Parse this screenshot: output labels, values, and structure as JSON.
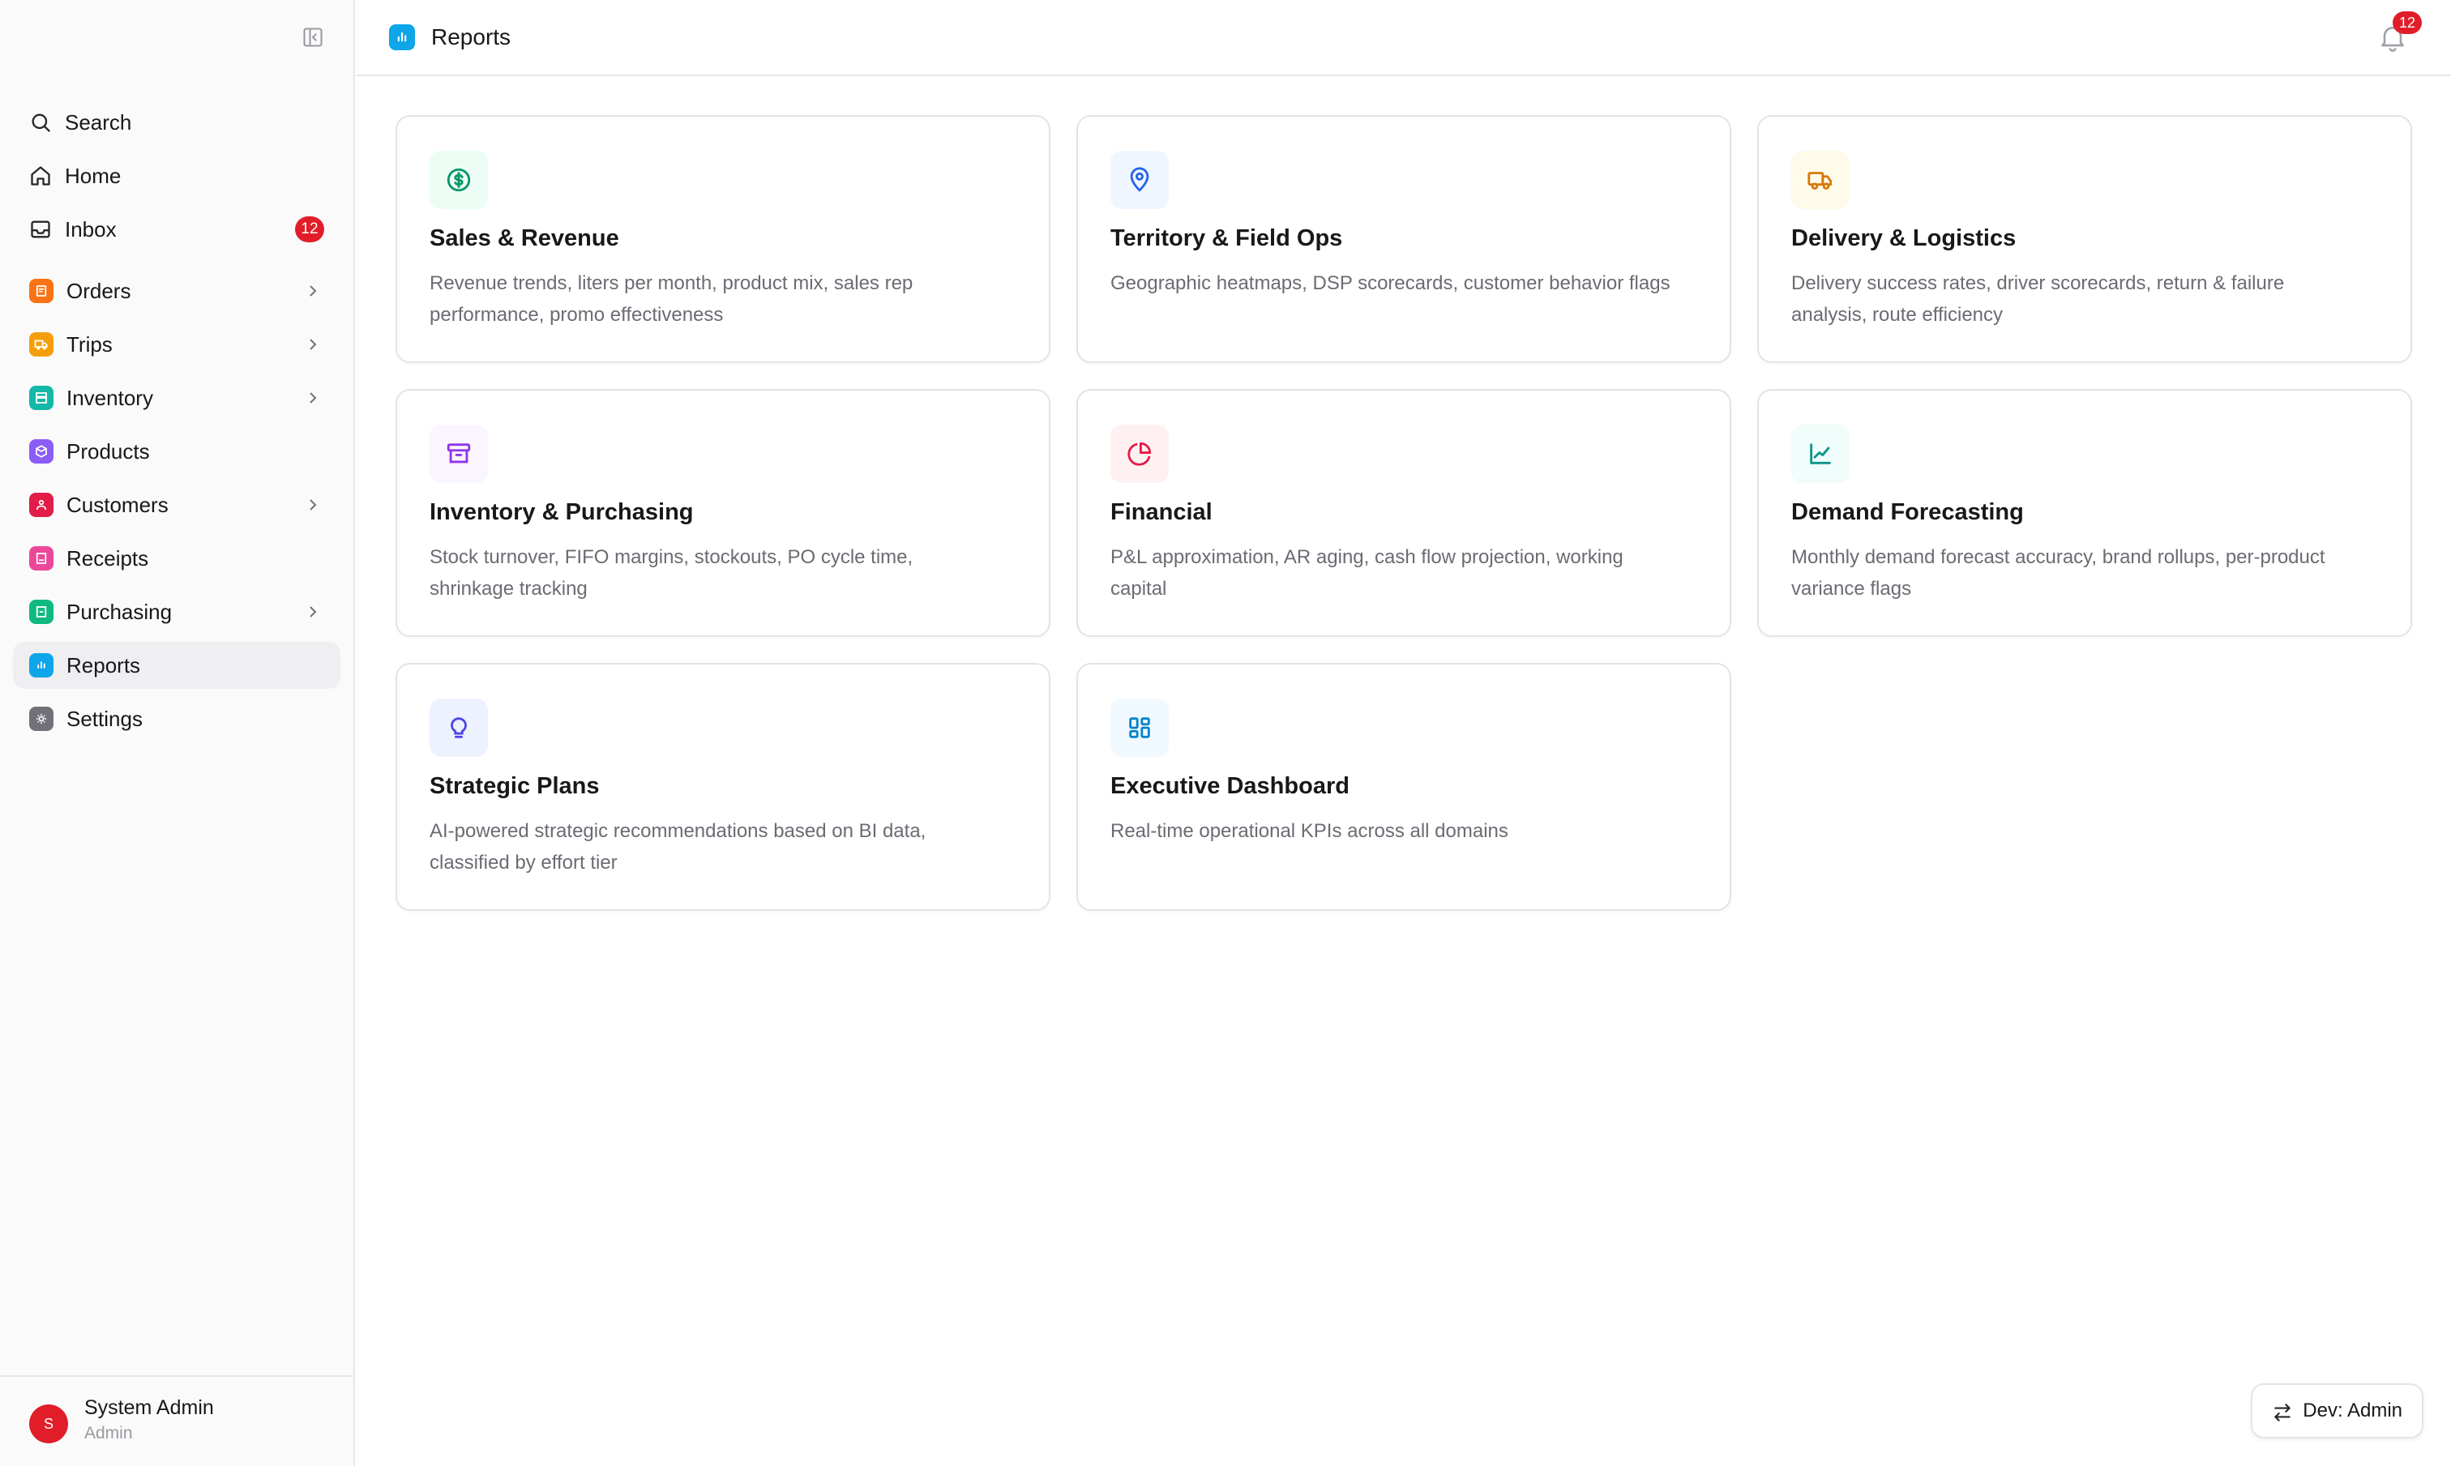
{
  "header": {
    "title": "Reports",
    "notifications": "12"
  },
  "sidebar": {
    "utility": [
      {
        "label": "Search",
        "icon": "search-icon"
      },
      {
        "label": "Home",
        "icon": "home-icon"
      },
      {
        "label": "Inbox",
        "icon": "inbox-icon",
        "badge": "12"
      }
    ],
    "items": [
      {
        "label": "Orders",
        "color": "#f97316",
        "has_submenu": true
      },
      {
        "label": "Trips",
        "color": "#f59e0b",
        "has_submenu": true
      },
      {
        "label": "Inventory",
        "color": "#14b8a6",
        "has_submenu": true
      },
      {
        "label": "Products",
        "color": "#8b5cf6",
        "has_submenu": false
      },
      {
        "label": "Customers",
        "color": "#e11d48",
        "has_submenu": true
      },
      {
        "label": "Receipts",
        "color": "#ec4899",
        "has_submenu": false
      },
      {
        "label": "Purchasing",
        "color": "#10b981",
        "has_submenu": true
      },
      {
        "label": "Reports",
        "color": "#0ea5e9",
        "has_submenu": false,
        "active": true
      },
      {
        "label": "Settings",
        "color": "#71717a",
        "has_submenu": false
      }
    ],
    "user": {
      "initial": "S",
      "name": "System Admin",
      "role": "Admin"
    }
  },
  "cards": [
    {
      "title": "Sales & Revenue",
      "description": "Revenue trends, liters per month, product mix, sales rep performance, promo effectiveness",
      "icon": "dollar-circle-icon",
      "color": "#059669",
      "bg": "#ecfdf5"
    },
    {
      "title": "Territory & Field Ops",
      "description": "Geographic heatmaps, DSP scorecards, customer behavior flags",
      "icon": "map-pin-icon",
      "color": "#2563eb",
      "bg": "#eff6ff"
    },
    {
      "title": "Delivery & Logistics",
      "description": "Delivery success rates, driver scorecards, return & failure analysis, route efficiency",
      "icon": "truck-icon",
      "color": "#d97706",
      "bg": "#fffbeb"
    },
    {
      "title": "Inventory & Purchasing",
      "description": "Stock turnover, FIFO margins, stockouts, PO cycle time, shrinkage tracking",
      "icon": "archive-icon",
      "color": "#9333ea",
      "bg": "#faf5ff"
    },
    {
      "title": "Financial",
      "description": "P&L approximation, AR aging, cash flow projection, working capital",
      "icon": "pie-chart-icon",
      "color": "#e11d48",
      "bg": "#fff1f2"
    },
    {
      "title": "Demand Forecasting",
      "description": "Monthly demand forecast accuracy, brand rollups, per-product variance flags",
      "icon": "trend-chart-icon",
      "color": "#0d9488",
      "bg": "#f0fdfa"
    },
    {
      "title": "Strategic Plans",
      "description": "AI-powered strategic recommendations based on BI data, classified by effort tier",
      "icon": "lightbulb-icon",
      "color": "#4f46e5",
      "bg": "#eef2ff"
    },
    {
      "title": "Executive Dashboard",
      "description": "Real-time operational KPIs across all domains",
      "icon": "dashboard-grid-icon",
      "color": "#0284c7",
      "bg": "#f0f9ff"
    }
  ],
  "dev_switch": {
    "label": "Dev: Admin"
  }
}
